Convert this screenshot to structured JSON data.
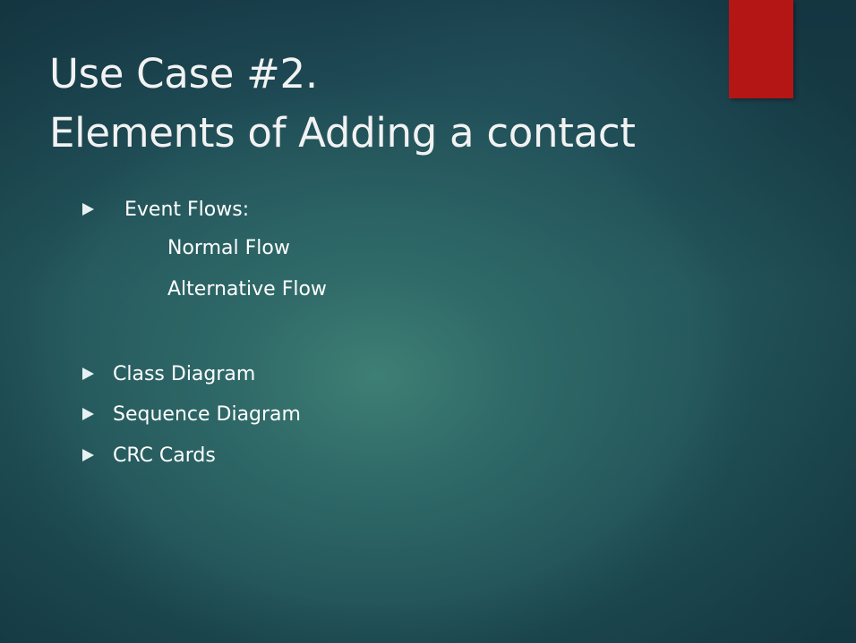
{
  "slide": {
    "title_line1": "Use Case #2.",
    "title_line2": "Elements of Adding a contact",
    "bullets": [
      {
        "label": "Event Flows:",
        "subitems": [
          "Normal Flow",
          "Alternative Flow"
        ]
      },
      {
        "label": "Class Diagram"
      },
      {
        "label": "Sequence Diagram"
      },
      {
        "label": "CRC Cards"
      }
    ]
  },
  "colors": {
    "accent_bar": "#b41616",
    "background": "#2f6968",
    "text": "#ffffff"
  },
  "icons": {
    "bullet": "triangle-right-icon"
  }
}
